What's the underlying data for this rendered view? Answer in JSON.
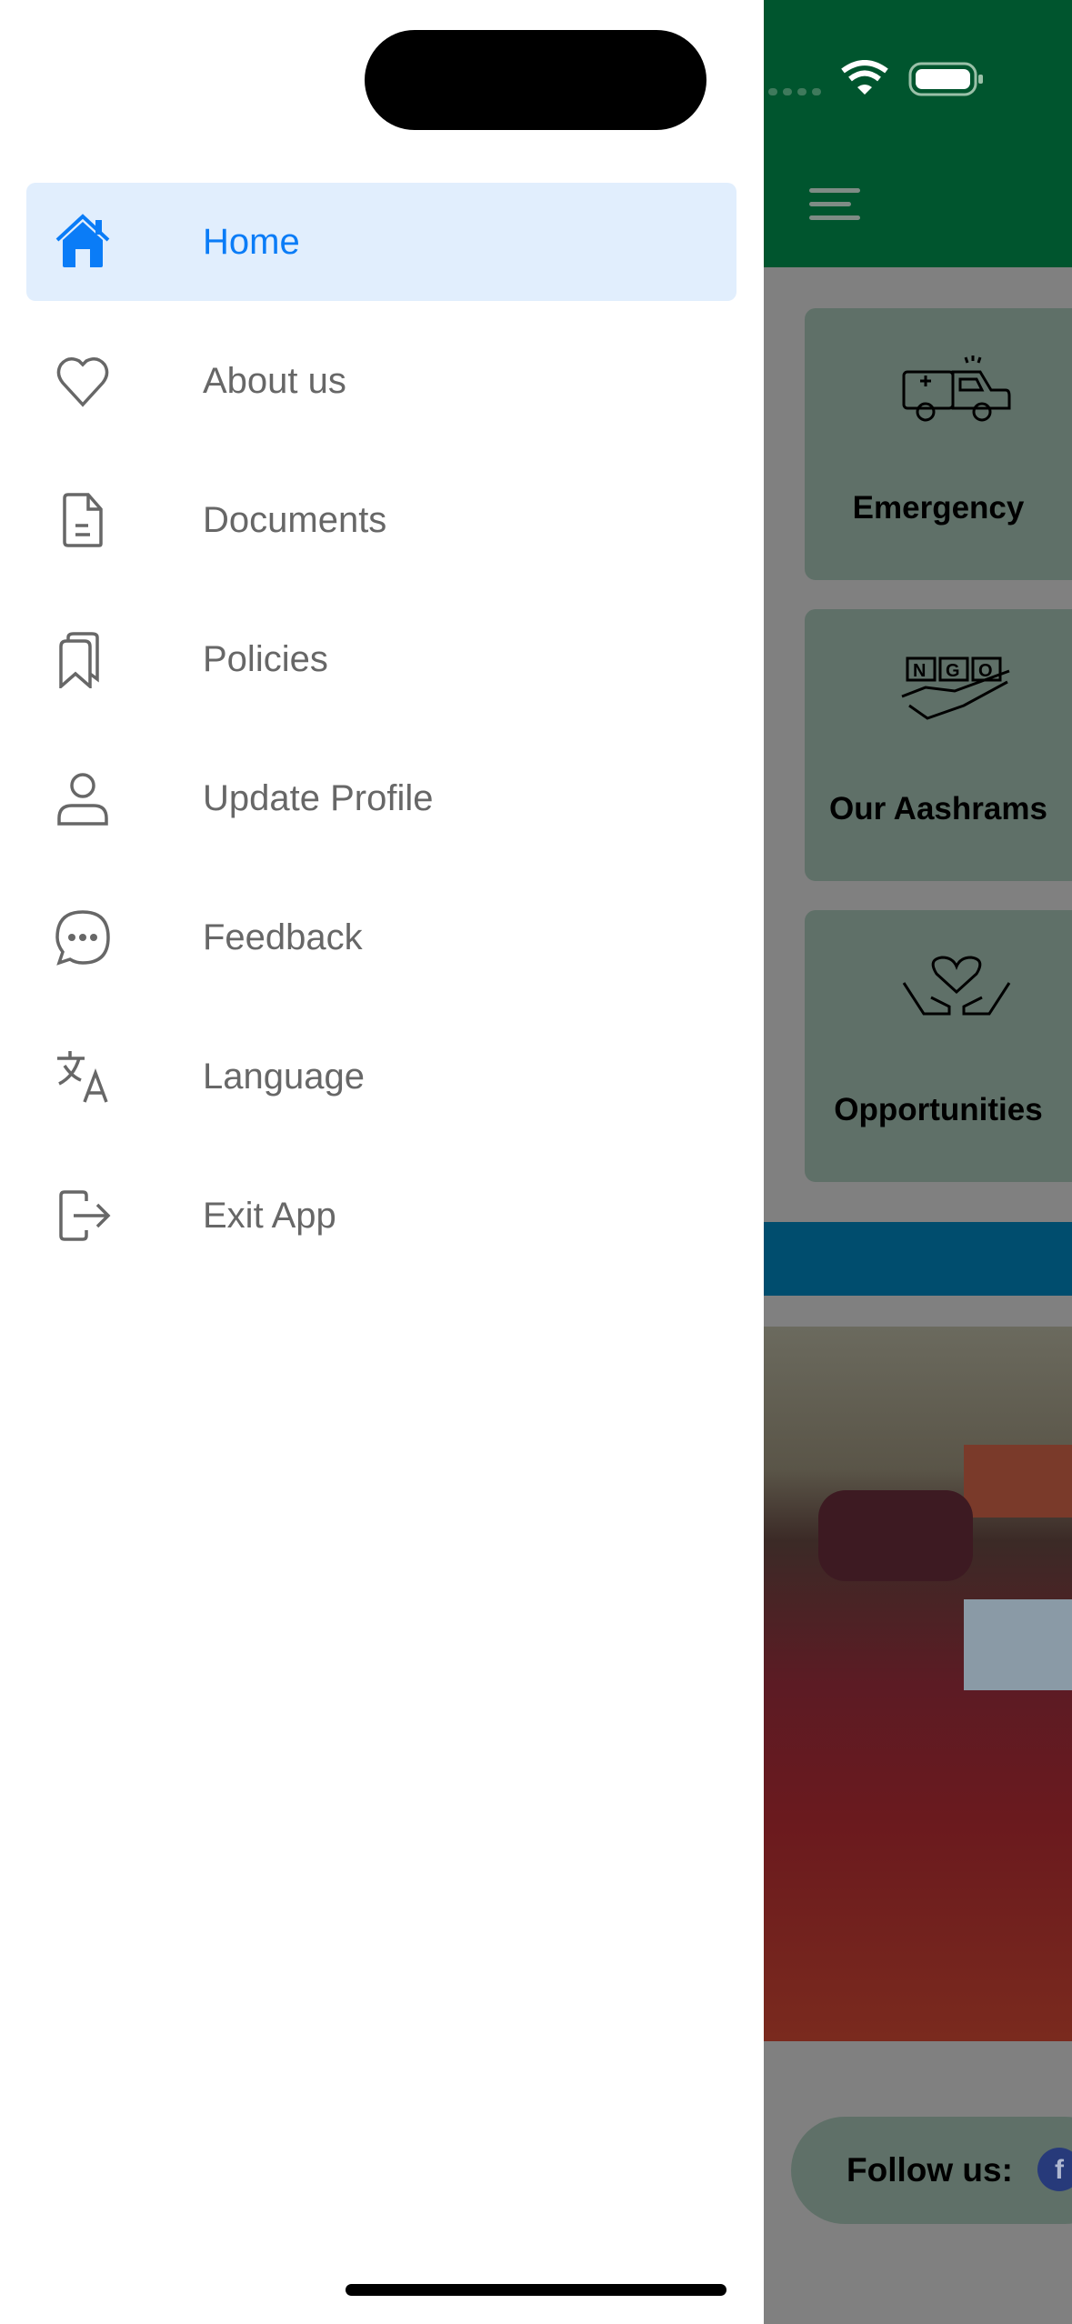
{
  "status_bar": {
    "wifi_icon": "wifi-icon",
    "battery_icon": "battery-icon"
  },
  "drawer": {
    "items": [
      {
        "label": "Home",
        "icon": "home-icon",
        "active": true
      },
      {
        "label": "About us",
        "icon": "heart-icon"
      },
      {
        "label": "Documents",
        "icon": "document-icon"
      },
      {
        "label": "Policies",
        "icon": "bookmarks-icon"
      },
      {
        "label": "Update Profile",
        "icon": "person-icon"
      },
      {
        "label": "Feedback",
        "icon": "chat-bubble-icon"
      },
      {
        "label": "Language",
        "icon": "translate-icon"
      },
      {
        "label": "Exit App",
        "icon": "exit-icon"
      }
    ],
    "active_color": "#0a7cf7",
    "active_bg": "#e1eefd"
  },
  "main": {
    "header_color": "#00552e",
    "cards": [
      {
        "label": "Emergency",
        "icon": "ambulance-icon"
      },
      {
        "label": "Our Aashrams",
        "icon": "ngo-hand-icon"
      },
      {
        "label": "Opportunities",
        "icon": "hands-heart-icon"
      }
    ],
    "follow_label": "Follow us:",
    "facebook_icon": "f"
  }
}
